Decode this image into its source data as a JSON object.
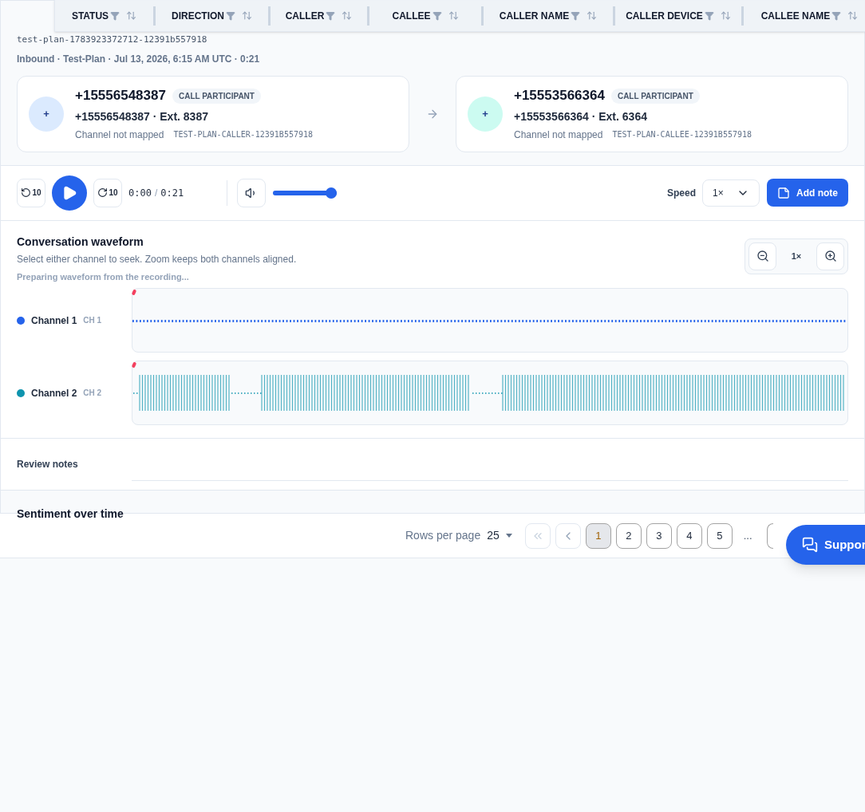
{
  "table_header": {
    "columns": [
      {
        "label": "STATUS"
      },
      {
        "label": "DIRECTION"
      },
      {
        "label": "CALLER"
      },
      {
        "label": "CALLEE"
      },
      {
        "label": "CALLER NAME"
      },
      {
        "label": "CALLER DEVICE"
      },
      {
        "label": "CALLEE NAME"
      }
    ]
  },
  "call": {
    "id": "test-plan-1783923372712-12391b557918",
    "meta": "Inbound · Test-Plan · Jul 13, 2026, 6:15 AM UTC · 0:21"
  },
  "participants": [
    {
      "avatar": "+",
      "number": "+15556548387",
      "badge": "CALL PARTICIPANT",
      "detail": "+15556548387 · Ext. 8387",
      "channel": "Channel not mapped",
      "code": "TEST-PLAN-CALLER-12391B557918",
      "color": "#dbeafe"
    },
    {
      "avatar": "+",
      "number": "+15553566364",
      "badge": "CALL PARTICIPANT",
      "detail": "+15553566364 · Ext. 6364",
      "channel": "Channel not mapped",
      "code": "TEST-PLAN-CALLEE-12391B557918",
      "color": "#ccfbf1"
    }
  ],
  "player": {
    "back": "10",
    "forward": "10",
    "current": "0:00",
    "separator": "/",
    "total": "0:21",
    "volume": {
      "level": 1
    },
    "speed_label": "Speed",
    "speed": "1×",
    "add_note": "Add note"
  },
  "waveform": {
    "title": "Conversation waveform",
    "subtitle": "Select either channel to seek. Zoom keeps both channels aligned.",
    "status": "Preparing waveform from the recording...",
    "zoom": "1×",
    "channels": [
      {
        "name": "Channel 1",
        "tag": "CH 1",
        "color": "#2563eb",
        "kind": "silent"
      },
      {
        "name": "Channel 2",
        "tag": "CH 2",
        "color": "#0e94ae",
        "kind": "speech"
      }
    ]
  },
  "review_notes": {
    "title": "Review notes"
  },
  "sentiment": {
    "title": "Sentiment over time"
  },
  "pagination": {
    "rows_label": "Rows per page",
    "rows_value": "25",
    "pages": [
      {
        "label": "1",
        "selected": true
      },
      {
        "label": "2",
        "selected": false
      },
      {
        "label": "3",
        "selected": false
      },
      {
        "label": "4",
        "selected": false
      },
      {
        "label": "5",
        "selected": false
      }
    ],
    "ellipsis": "..."
  },
  "support": {
    "label": "Suppor"
  }
}
